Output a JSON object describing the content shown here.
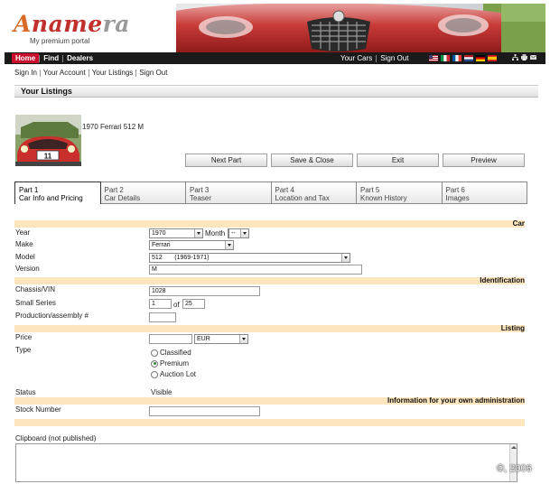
{
  "logo": {
    "word": "Anamera",
    "tagline": "My premium portal"
  },
  "nav": {
    "left": [
      "Home",
      "Find",
      "Dealers"
    ],
    "right": [
      "Your Cars",
      "Sign Out"
    ],
    "flags": [
      "en",
      "it",
      "fr",
      "nl",
      "de",
      "es"
    ],
    "tools": [
      "sitemap-icon",
      "print-icon",
      "mail-icon"
    ]
  },
  "subnav": [
    "Sign In",
    "Your Account",
    "Your Listings",
    "Sign Out"
  ],
  "section_title": "Your Listings",
  "car": {
    "title": "1970 Ferrari 512 M",
    "plate_number": "11"
  },
  "buttons": {
    "next": "Next Part",
    "save_close": "Save & Close",
    "exit": "Exit",
    "preview": "Preview"
  },
  "tabs": [
    {
      "num": "Part 1",
      "name": "Car Info and Pricing"
    },
    {
      "num": "Part 2",
      "name": "Car Details"
    },
    {
      "num": "Part 3",
      "name": "Teaser"
    },
    {
      "num": "Part 4",
      "name": "Location and Tax"
    },
    {
      "num": "Part 5",
      "name": "Known History"
    },
    {
      "num": "Part 6",
      "name": "Images"
    }
  ],
  "form": {
    "car_band": "Car",
    "year_label": "Year",
    "year_value": "1970",
    "month_label": "Month",
    "month_value": "--",
    "make_label": "Make",
    "make_value": "Ferrari",
    "model_label": "Model",
    "model_value": "512       (1969-1971)",
    "version_label": "Version",
    "version_value": "M",
    "ident_band": "Identification",
    "chassis_label": "Chassis/VIN",
    "chassis_value": "1028",
    "series_label": "Small Series",
    "series_value": "1",
    "series_of": "of",
    "series_total": "25",
    "production_label": "Production/assembly #",
    "production_value": "",
    "listing_band": "Listing",
    "price_label": "Price",
    "price_value": "",
    "currency_value": "EUR",
    "type_label": "Type",
    "types": [
      "Classified",
      "Premium",
      "Auction Lot"
    ],
    "type_selected": 1,
    "status_label": "Status",
    "status_value": "Visible",
    "admin_band": "Information for your own administration",
    "stock_label": "Stock Number",
    "stock_value": "",
    "clipboard_label": "Clipboard (not published)"
  },
  "copyright": "©, 2006",
  "colors": {
    "accent_red": "#c8102e",
    "band_bg": "#fde5bd",
    "nav_bg": "#1a1a1a"
  }
}
